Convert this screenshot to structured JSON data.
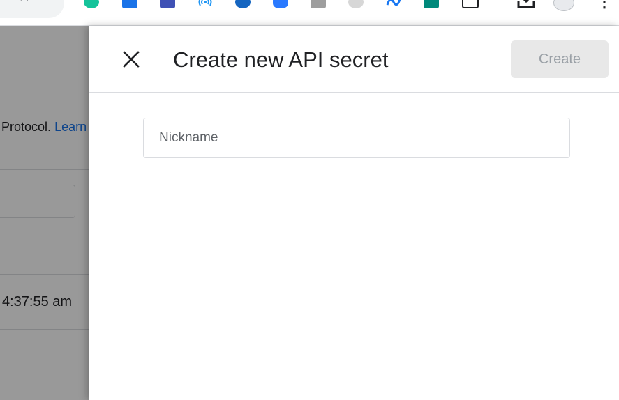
{
  "browser": {
    "omnibox_text": "...",
    "extensions": [
      {
        "name": "grammarly-icon",
        "color": "#15c39a"
      },
      {
        "name": "snowflake-icon",
        "color": "#1a73e8"
      },
      {
        "name": "photo-frame-icon",
        "color": "#3f51b5"
      },
      {
        "name": "broadcast-icon",
        "color": "#2196f3"
      },
      {
        "name": "shield-icon",
        "color": "#1565c0"
      },
      {
        "name": "bug-icon",
        "color": "#2979ff"
      },
      {
        "name": "camera-icon",
        "color": "#9e9e9e"
      },
      {
        "name": "link-icon",
        "color": "#bdbdbd"
      },
      {
        "name": "meta-icon",
        "color": "#1877f2"
      },
      {
        "name": "pulse-icon",
        "color": "#00897b"
      },
      {
        "name": "puzzle-icon",
        "color": "#202124"
      }
    ]
  },
  "background": {
    "description": "Protocol.",
    "learn_link": "Learn",
    "time": "4:37:55 am"
  },
  "dialog": {
    "title": "Create new API secret",
    "create_label": "Create",
    "nickname_placeholder": "Nickname",
    "nickname_value": ""
  }
}
